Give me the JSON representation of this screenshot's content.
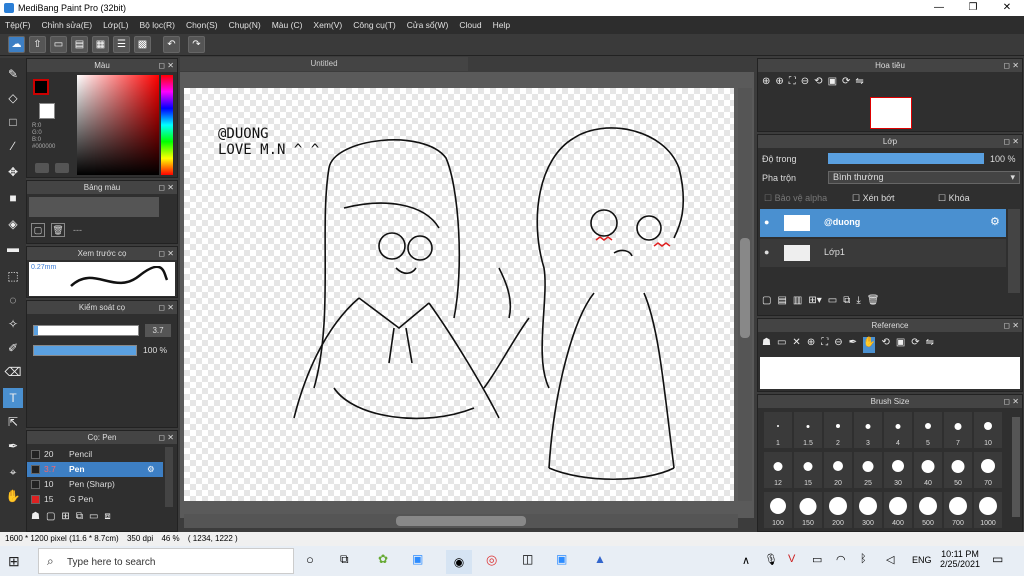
{
  "window": {
    "title": "MediBang Paint Pro (32bit)",
    "min": "—",
    "max": "❐",
    "close": "✕"
  },
  "menu": [
    "Tệp(F)",
    "Chỉnh sửa(E)",
    "Lớp(L)",
    "Bộ lọc(R)",
    "Chọn(S)",
    "Chụp(N)",
    "Màu (C)",
    "Xem(V)",
    "Công cụ(T)",
    "Cửa sổ(W)",
    "Cloud",
    "Help"
  ],
  "document": {
    "tab": "Untitled"
  },
  "artwork": {
    "line1": "@DUONG",
    "line2": "LOVE M.N ^ ^"
  },
  "color_panel": {
    "title": "Màu",
    "r": "R:0",
    "g": "G:0",
    "b": "B:0",
    "hex": "#000000",
    "fg": "#000000",
    "accent": "#cc0000"
  },
  "palette_panel": {
    "title": "Bảng màu",
    "value": "---"
  },
  "brush_preview": {
    "title": "Xem trước cọ",
    "size": "0.27mm"
  },
  "brush_control": {
    "title": "Kiểm soát cọ",
    "size_value": "3.7",
    "opacity_value": "100 %",
    "opacity": 1.0
  },
  "brush_list": {
    "title": "Cọ: Pen",
    "items": [
      {
        "size": "20",
        "name": "Pencil",
        "color": "#222222"
      },
      {
        "size": "3.7",
        "name": "Pen",
        "color": "#222222",
        "selected": true
      },
      {
        "size": "10",
        "name": "Pen (Sharp)",
        "color": "#222222"
      },
      {
        "size": "15",
        "name": "G Pen",
        "color": "#cc2222"
      }
    ]
  },
  "navigator": {
    "title": "Hoa tiêu"
  },
  "layers": {
    "title": "Lớp",
    "opacity_label": "Độ trong",
    "opacity_value": "100 %",
    "opacity": 1.0,
    "blend_label": "Pha trộn",
    "blend_value": "Bình thường",
    "protect_alpha": "Bảo vệ alpha",
    "clipping": "Xén bớt",
    "lock": "Khóa",
    "items": [
      {
        "name": "@duong",
        "selected": true
      },
      {
        "name": "Lớp1",
        "selected": false
      }
    ]
  },
  "reference": {
    "title": "Reference"
  },
  "brush_size": {
    "title": "Brush Size",
    "sizes": [
      "1",
      "1.5",
      "2",
      "3",
      "4",
      "5",
      "7",
      "10",
      "12",
      "15",
      "20",
      "25",
      "30",
      "40",
      "50",
      "70",
      "100",
      "150",
      "200",
      "300",
      "400",
      "500",
      "700",
      "1000"
    ]
  },
  "status": {
    "dimensions": "1600 * 1200 pixel",
    "cm": "(11.6 * 8.7cm)",
    "dpi": "350 dpi",
    "zoom": "46 %",
    "coords": "( 1234, 1222 )"
  },
  "taskbar": {
    "search_placeholder": "Type here to search",
    "time": "10:11 PM",
    "date": "2/25/2021",
    "lang": "ENG"
  }
}
